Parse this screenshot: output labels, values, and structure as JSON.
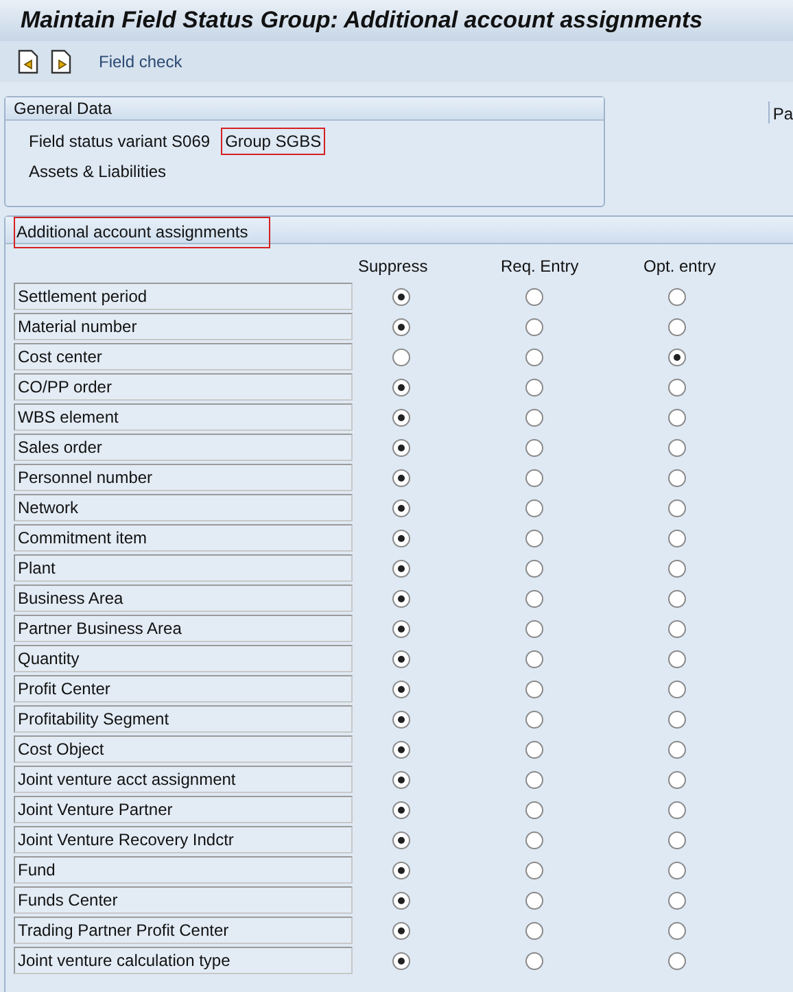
{
  "window": {
    "title": "Maintain Field Status Group: Additional account assignments"
  },
  "toolbar": {
    "buttons": [
      {
        "kind": "previous"
      },
      {
        "kind": "next"
      }
    ],
    "label": "Field check"
  },
  "general_data": {
    "title": "General Data",
    "variant": "Field status variant S069",
    "group": {
      "text": "Group SGBS",
      "highlighted": true
    },
    "description": "Assets & Liabilities",
    "side_label": "Pa"
  },
  "assignments": {
    "title": {
      "text": "Additional account assignments",
      "highlighted": true
    },
    "columns": [
      "Suppress",
      "Req. Entry",
      "Opt. entry"
    ],
    "rows": [
      {
        "label": "Settlement period",
        "options": [
          {
            "selected": true
          },
          {
            "selected": false
          },
          {
            "selected": false
          }
        ]
      },
      {
        "label": "Material number",
        "options": [
          {
            "selected": true
          },
          {
            "selected": false
          },
          {
            "selected": false
          }
        ]
      },
      {
        "label": "Cost center",
        "options": [
          {
            "selected": false
          },
          {
            "selected": false
          },
          {
            "selected": true
          }
        ]
      },
      {
        "label": "CO/PP order",
        "options": [
          {
            "selected": true
          },
          {
            "selected": false
          },
          {
            "selected": false
          }
        ]
      },
      {
        "label": "WBS element",
        "options": [
          {
            "selected": true
          },
          {
            "selected": false
          },
          {
            "selected": false
          }
        ]
      },
      {
        "label": "Sales order",
        "options": [
          {
            "selected": true
          },
          {
            "selected": false
          },
          {
            "selected": false
          }
        ]
      },
      {
        "label": "Personnel number",
        "options": [
          {
            "selected": true
          },
          {
            "selected": false
          },
          {
            "selected": false
          }
        ]
      },
      {
        "label": "Network",
        "options": [
          {
            "selected": true
          },
          {
            "selected": false
          },
          {
            "selected": false
          }
        ]
      },
      {
        "label": "Commitment item",
        "options": [
          {
            "selected": true
          },
          {
            "selected": false
          },
          {
            "selected": false
          }
        ]
      },
      {
        "label": "Plant",
        "options": [
          {
            "selected": true
          },
          {
            "selected": false
          },
          {
            "selected": false
          }
        ]
      },
      {
        "label": "Business Area",
        "options": [
          {
            "selected": true
          },
          {
            "selected": false
          },
          {
            "selected": false
          }
        ]
      },
      {
        "label": "Partner Business Area",
        "options": [
          {
            "selected": true
          },
          {
            "selected": false
          },
          {
            "selected": false
          }
        ]
      },
      {
        "label": "Quantity",
        "options": [
          {
            "selected": true
          },
          {
            "selected": false
          },
          {
            "selected": false
          }
        ]
      },
      {
        "label": "Profit Center",
        "options": [
          {
            "selected": true
          },
          {
            "selected": false
          },
          {
            "selected": false
          }
        ]
      },
      {
        "label": "Profitability Segment",
        "options": [
          {
            "selected": true
          },
          {
            "selected": false
          },
          {
            "selected": false
          }
        ]
      },
      {
        "label": "Cost Object",
        "options": [
          {
            "selected": true
          },
          {
            "selected": false
          },
          {
            "selected": false
          }
        ]
      },
      {
        "label": "Joint venture acct assignment",
        "options": [
          {
            "selected": true
          },
          {
            "selected": false
          },
          {
            "selected": false
          }
        ]
      },
      {
        "label": "Joint Venture Partner",
        "options": [
          {
            "selected": true
          },
          {
            "selected": false
          },
          {
            "selected": false
          }
        ]
      },
      {
        "label": "Joint Venture Recovery Indctr",
        "options": [
          {
            "selected": true
          },
          {
            "selected": false
          },
          {
            "selected": false
          }
        ]
      },
      {
        "label": "Fund",
        "options": [
          {
            "selected": true
          },
          {
            "selected": false
          },
          {
            "selected": false
          }
        ]
      },
      {
        "label": "Funds Center",
        "options": [
          {
            "selected": true
          },
          {
            "selected": false
          },
          {
            "selected": false
          }
        ]
      },
      {
        "label": "Trading Partner Profit Center",
        "options": [
          {
            "selected": true
          },
          {
            "selected": false
          },
          {
            "selected": false
          }
        ]
      },
      {
        "label": "Joint venture calculation type",
        "options": [
          {
            "selected": true
          },
          {
            "selected": false
          },
          {
            "selected": false
          }
        ]
      }
    ]
  }
}
